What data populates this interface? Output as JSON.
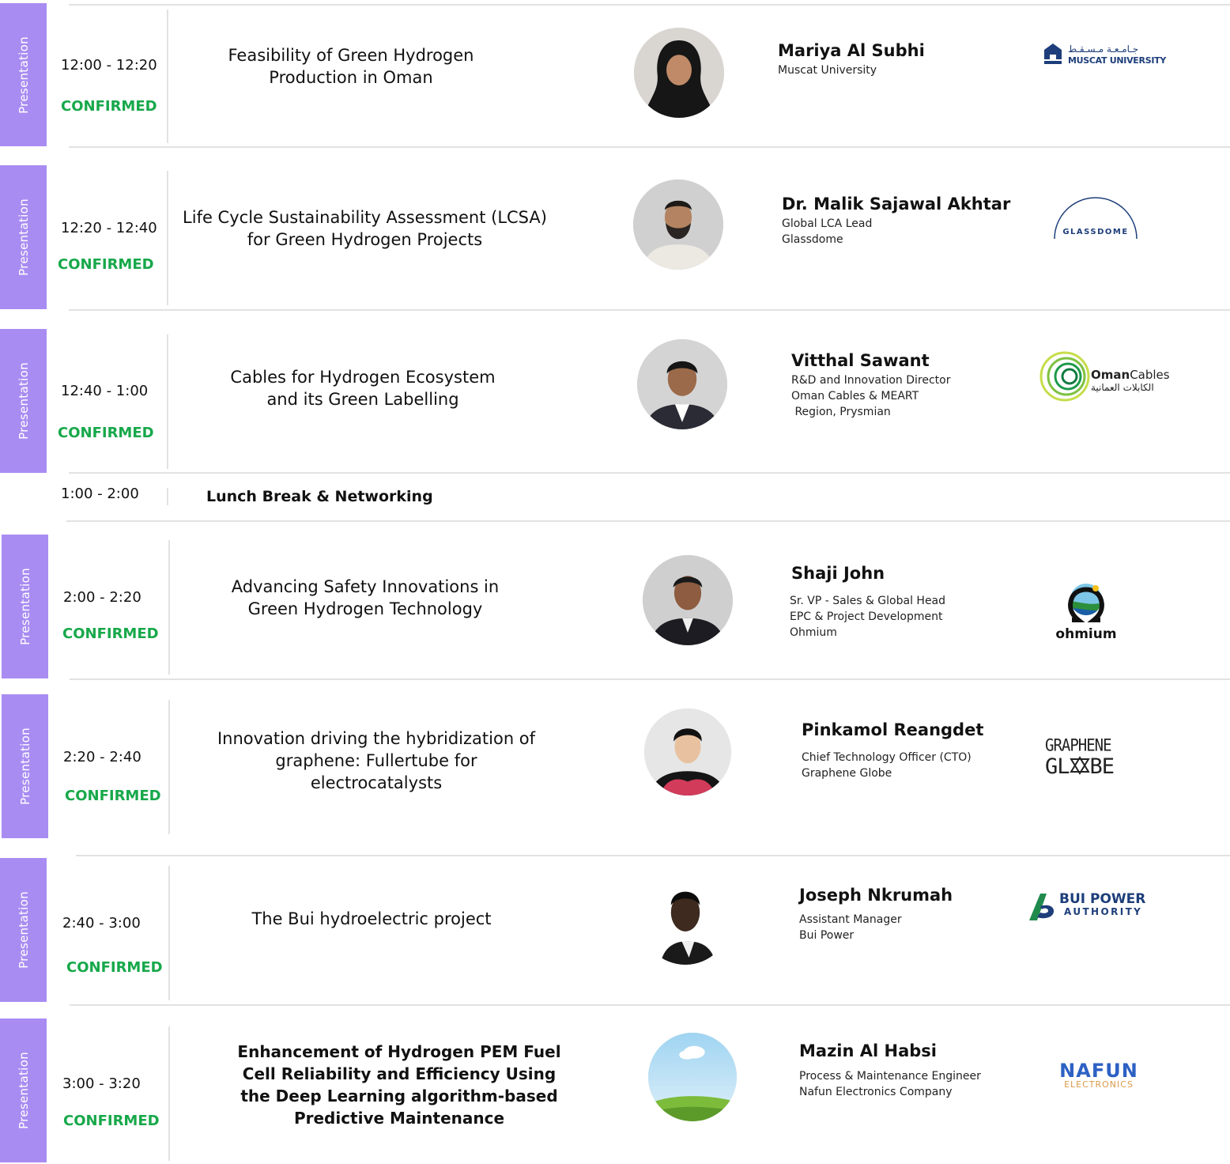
{
  "tag_label": "Presentation",
  "sessions": [
    {
      "time": "12:00 - 12:20",
      "status": "CONFIRMED",
      "title": "Feasibility of Green Hydrogen Production in Oman",
      "speaker": "Mariya Al Subhi",
      "role": "Muscat University",
      "logo": {
        "arabic": "جـامـعـة مـسـقـط",
        "text": "MUSCAT UNIVERSITY"
      }
    },
    {
      "time": "12:20 - 12:40",
      "status": "CONFIRMED",
      "title": "Life Cycle Sustainability Assessment (LCSA) for Green Hydrogen Projects",
      "speaker": "Dr. Malik Sajawal Akhtar",
      "role": "Global LCA Lead\nGlassdome",
      "logo": {
        "text": "GLASSDOME"
      }
    },
    {
      "time": "12:40 - 1:00",
      "status": "CONFIRMED",
      "title": "Cables for Hydrogen Ecosystem and its Green Labelling",
      "speaker": "Vitthal Sawant",
      "role": "R&D and Innovation Director\nOman Cables & MEART\n Region, Prysmian",
      "logo": {
        "text_bold": "Oman",
        "text_light": "Cables",
        "arabic": "الكابلات العمانية"
      }
    },
    {
      "time": "2:00 - 2:20",
      "status": "CONFIRMED",
      "title": "Advancing Safety Innovations in Green Hydrogen Technology",
      "speaker": "Shaji John",
      "role": "Sr. VP - Sales & Global Head\nEPC & Project Development\nOhmium",
      "logo": {
        "text": "ohmium"
      }
    },
    {
      "time": "2:20 - 2:40",
      "status": "CONFIRMED",
      "title": "Innovation driving the  hybridization of graphene: Fullertube for electrocatalysts",
      "speaker": "Pinkamol Reangdet",
      "role": "Chief Technology Officer (CTO)\nGraphene Globe",
      "logo": {
        "line1": "GRAPHENE",
        "line2_a": "GL",
        "line2_b": "BE"
      }
    },
    {
      "time": "2:40 - 3:00",
      "status": "CONFIRMED",
      "title": "The Bui hydroelectric project",
      "speaker": "Joseph Nkrumah",
      "role": "Assistant Manager\nBui Power",
      "logo": {
        "line1": "BUI POWER",
        "line2": "AUTHORITY"
      }
    },
    {
      "time": "3:00 - 3:20",
      "status": "CONFIRMED",
      "title": "Enhancement of Hydrogen PEM Fuel Cell Reliability and Efficiency Using the Deep Learning algorithm-based Predictive Maintenance",
      "speaker": "Mazin Al Habsi",
      "role": "Process & Maintenance Engineer\nNafun Electronics Company",
      "logo": {
        "line1": "NAFUN",
        "line2": "ELECTRONICS"
      }
    }
  ],
  "lunch": {
    "time": "1:00 - 2:00",
    "label": "Lunch Break & Networking"
  },
  "colors": {
    "tag": "#a98cf2",
    "confirmed": "#17a84a",
    "divider": "#e2e2e2"
  }
}
